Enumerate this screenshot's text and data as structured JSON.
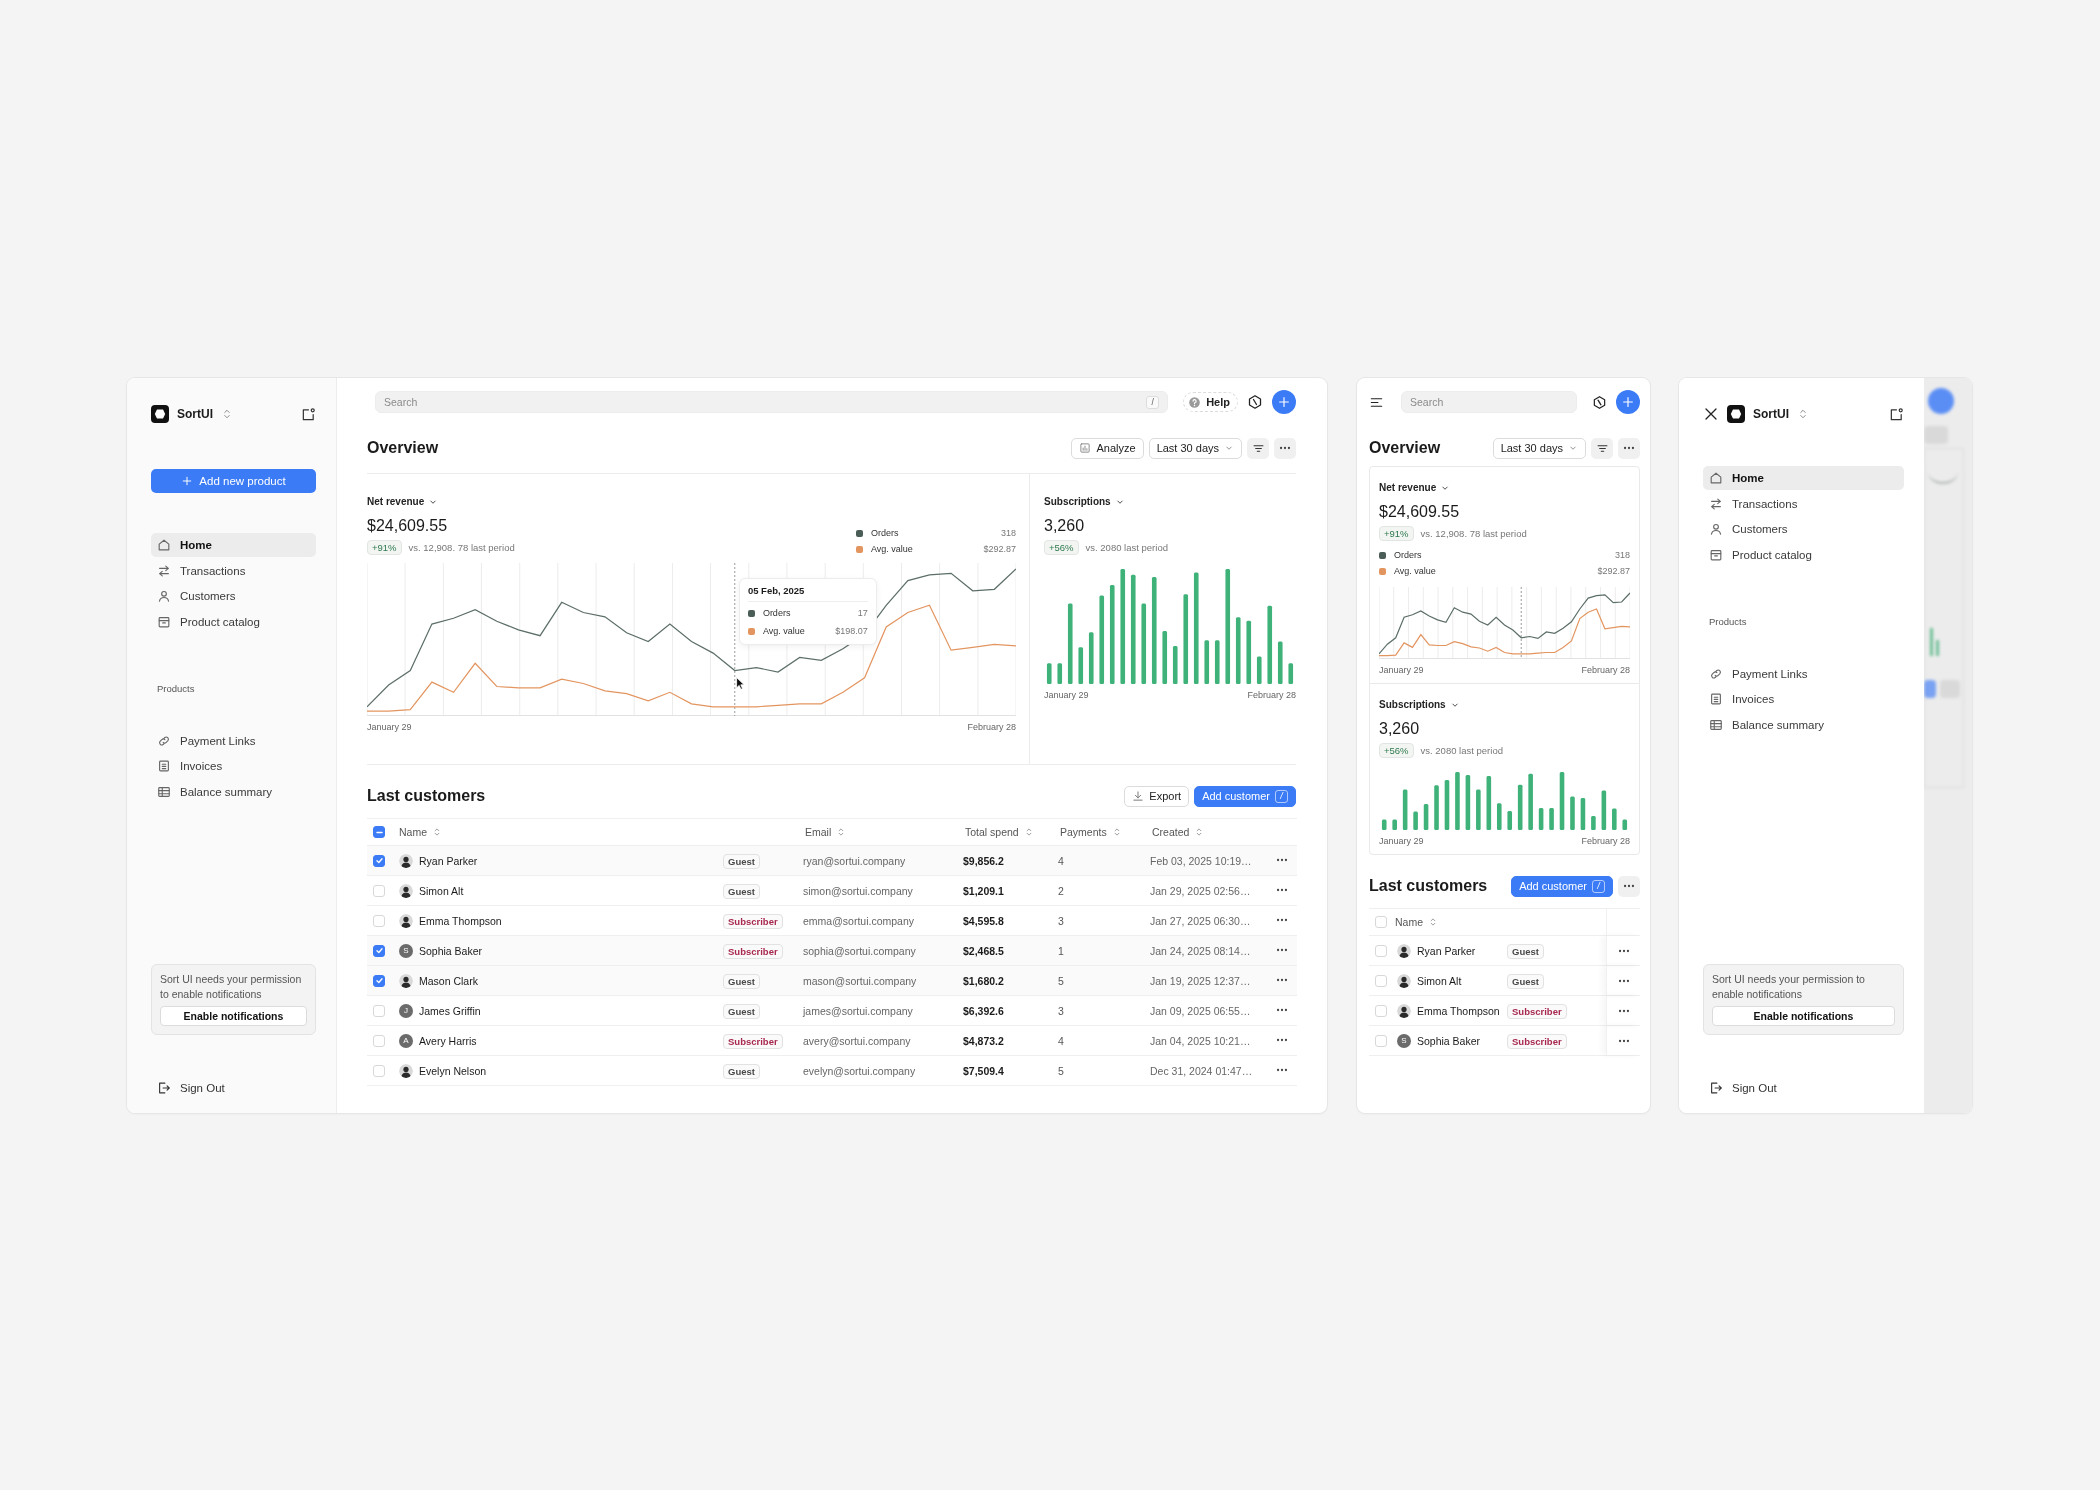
{
  "desktop": {
    "sidebar": {
      "brand": "SortUI",
      "add_button": "Add new product",
      "nav": [
        {
          "label": "Home",
          "selected": true
        },
        {
          "label": "Transactions",
          "selected": false
        },
        {
          "label": "Customers",
          "selected": false
        },
        {
          "label": "Product catalog",
          "selected": false
        }
      ],
      "section_title": "Products",
      "section_nav": [
        {
          "label": "Payment Links",
          "selected": false
        },
        {
          "label": "Invoices",
          "selected": false
        },
        {
          "label": "Balance summary",
          "selected": false
        }
      ],
      "notice": "Sort UI needs your permission to enable notifications",
      "notice_button": "Enable notifications",
      "sign_out": "Sign Out"
    },
    "search": {
      "placeholder": "Search",
      "shortcut": "/"
    },
    "help": "Help",
    "title": "Overview",
    "analyze": "Analyze",
    "range": "Last 30 days",
    "revenue": {
      "label": "Net revenue",
      "value": "$24,609.55",
      "change": "+91%",
      "comparison": "vs. 12,908. 78 last period",
      "legend": [
        {
          "name": "Orders",
          "value": "318",
          "color": "#4b5d57"
        },
        {
          "name": "Avg. value",
          "value": "$292.87",
          "color": "#e39560"
        }
      ],
      "x_start": "January 29",
      "x_end": "February 28",
      "tooltip": {
        "date": "05 Feb, 2025",
        "rows": [
          {
            "name": "Orders",
            "value": "17",
            "color": "#4b5d57"
          },
          {
            "name": "Avg. value",
            "value": "$198.07",
            "color": "#e39560"
          }
        ]
      }
    },
    "subscriptions": {
      "label": "Subscriptions",
      "value": "3,260",
      "change": "+56%",
      "comparison": "vs. 2080 last period",
      "x_start": "January 29",
      "x_end": "February 28"
    },
    "customers": {
      "title": "Last customers",
      "export": "Export",
      "add": "Add customer",
      "add_shortcut": "/",
      "header_indeterminate": true,
      "columns": [
        "Name",
        "Email",
        "Total spend",
        "Payments",
        "Created"
      ],
      "rows": [
        {
          "name": "Ryan Parker",
          "avatar": {
            "kind": "photo"
          },
          "tag": {
            "label": "Guest",
            "color": "#4a4a4a"
          },
          "email": "ryan@sortui.company",
          "spend": "$9,856.2",
          "payments": "4",
          "created": "Feb 03, 2025 10:19…",
          "selected": true
        },
        {
          "name": "Simon Alt",
          "avatar": {
            "kind": "photo"
          },
          "tag": {
            "label": "Guest",
            "color": "#4a4a4a"
          },
          "email": "simon@sortui.company",
          "spend": "$1,209.1",
          "payments": "2",
          "created": "Jan 29, 2025 02:56…",
          "selected": false
        },
        {
          "name": "Emma Thompson",
          "avatar": {
            "kind": "photo"
          },
          "tag": {
            "label": "Subscriber",
            "color": "#a8294f"
          },
          "email": "emma@sortui.company",
          "spend": "$4,595.8",
          "payments": "3",
          "created": "Jan 27, 2025 06:30…",
          "selected": false
        },
        {
          "name": "Sophia Baker",
          "avatar": {
            "kind": "letter",
            "initial": "S"
          },
          "tag": {
            "label": "Subscriber",
            "color": "#a8294f"
          },
          "email": "sophia@sortui.company",
          "spend": "$2,468.5",
          "payments": "1",
          "created": "Jan 24, 2025 08:14…",
          "selected": true
        },
        {
          "name": "Mason Clark",
          "avatar": {
            "kind": "photo"
          },
          "tag": {
            "label": "Guest",
            "color": "#4a4a4a"
          },
          "email": "mason@sortui.company",
          "spend": "$1,680.2",
          "payments": "5",
          "created": "Jan 19, 2025 12:37…",
          "selected": true
        },
        {
          "name": "James Griffin",
          "avatar": {
            "kind": "letter",
            "initial": "J"
          },
          "tag": {
            "label": "Guest",
            "color": "#4a4a4a"
          },
          "email": "james@sortui.company",
          "spend": "$6,392.6",
          "payments": "3",
          "created": "Jan 09, 2025 06:55…",
          "selected": false
        },
        {
          "name": "Avery Harris",
          "avatar": {
            "kind": "letter",
            "initial": "A"
          },
          "tag": {
            "label": "Subscriber",
            "color": "#a8294f"
          },
          "email": "avery@sortui.company",
          "spend": "$4,873.2",
          "payments": "4",
          "created": "Jan 04, 2025 10:21…",
          "selected": false
        },
        {
          "name": "Evelyn Nelson",
          "avatar": {
            "kind": "photo"
          },
          "tag": {
            "label": "Guest",
            "color": "#4a4a4a"
          },
          "email": "evelyn@sortui.company",
          "spend": "$7,509.4",
          "payments": "5",
          "created": "Dec 31, 2024 01:47…",
          "selected": false
        }
      ]
    }
  },
  "tablet": {
    "search": {
      "placeholder": "Search"
    },
    "title": "Overview",
    "range": "Last 30 days",
    "revenue": {
      "label": "Net revenue",
      "value": "$24,609.55",
      "change": "+91%",
      "comparison": "vs. 12,908. 78 last period",
      "legend": [
        {
          "name": "Orders",
          "value": "318",
          "color": "#4b5d57"
        },
        {
          "name": "Avg. value",
          "value": "$292.87",
          "color": "#e39560"
        }
      ],
      "x_start": "January 29",
      "x_end": "February 28"
    },
    "subscriptions": {
      "label": "Subscriptions",
      "value": "3,260",
      "change": "+56%",
      "comparison": "vs. 2080 last period",
      "x_start": "January 29",
      "x_end": "February 28"
    },
    "customers": {
      "title": "Last customers",
      "add": "Add customer",
      "add_shortcut": "/",
      "header_checked": false,
      "column": "Name",
      "rows": [
        {
          "name": "Ryan Parker",
          "avatar": {
            "kind": "photo"
          },
          "tag": {
            "label": "Guest",
            "color": "#4a4a4a"
          },
          "selected": false
        },
        {
          "name": "Simon Alt",
          "avatar": {
            "kind": "photo"
          },
          "tag": {
            "label": "Guest",
            "color": "#4a4a4a"
          },
          "selected": false
        },
        {
          "name": "Emma Thompson",
          "avatar": {
            "kind": "photo"
          },
          "tag": {
            "label": "Subscriber",
            "color": "#a8294f"
          },
          "selected": false
        },
        {
          "name": "Sophia Baker",
          "avatar": {
            "kind": "letter",
            "initial": "S"
          },
          "tag": {
            "label": "Subscriber",
            "color": "#a8294f"
          },
          "selected": false
        }
      ]
    }
  },
  "mobile": {
    "sidebar": {
      "brand": "SortUI",
      "nav": [
        {
          "label": "Home",
          "selected": true
        },
        {
          "label": "Transactions",
          "selected": false
        },
        {
          "label": "Customers",
          "selected": false
        },
        {
          "label": "Product catalog",
          "selected": false
        }
      ],
      "section_title": "Products",
      "section_nav": [
        {
          "label": "Payment Links",
          "selected": false
        },
        {
          "label": "Invoices",
          "selected": false
        },
        {
          "label": "Balance summary",
          "selected": false
        }
      ],
      "notice": "Sort UI needs your permission to enable notifications",
      "notice_button": "Enable notifications",
      "sign_out": "Sign Out"
    }
  }
}
